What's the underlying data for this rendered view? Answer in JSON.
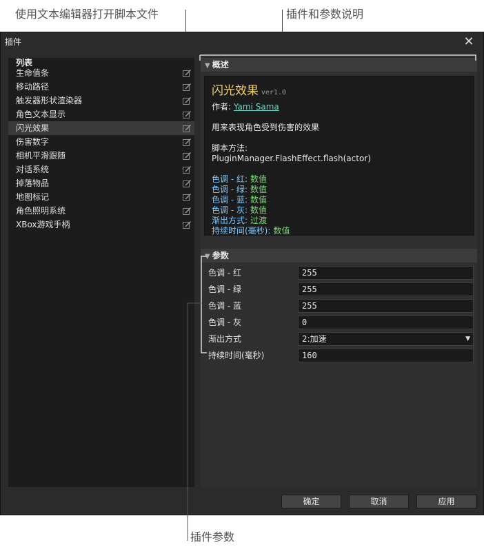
{
  "annotations": {
    "open_in_editor": "使用文本编辑器打开脚本文件",
    "plugin_description": "插件和参数说明",
    "plugin_params": "插件参数"
  },
  "dialog": {
    "title": "插件",
    "close_icon": "close-icon"
  },
  "list": {
    "header": "列表",
    "items": [
      {
        "label": "生命值条"
      },
      {
        "label": "移动路径"
      },
      {
        "label": "触发器形状渲染器"
      },
      {
        "label": "角色文本显示"
      },
      {
        "label": "闪光效果",
        "selected": true
      },
      {
        "label": "伤害数字"
      },
      {
        "label": "相机平滑跟随"
      },
      {
        "label": "对话系统"
      },
      {
        "label": "掉落物品"
      },
      {
        "label": "地图标记"
      },
      {
        "label": "角色照明系统"
      },
      {
        "label": "XBox游戏手柄"
      }
    ],
    "item_icon": "edit-icon"
  },
  "overview": {
    "header": "概述",
    "title": "闪光效果",
    "version": "ver1.0",
    "author_label": "作者:",
    "author_name": "Yami Sama",
    "description": "用来表现角色受到伤害的效果",
    "script_method_label": "脚本方法:",
    "script_method": "PluginManager.FlashEffect.flash(actor)",
    "params": [
      {
        "name": "色调 - 红:",
        "type": "数值"
      },
      {
        "name": "色调 - 绿:",
        "type": "数值"
      },
      {
        "name": "色调 - 蓝:",
        "type": "数值"
      },
      {
        "name": "色调 - 灰:",
        "type": "数值"
      },
      {
        "name": "渐出方式:",
        "type": "过渡"
      },
      {
        "name": "持续时间(毫秒):",
        "type": "数值"
      }
    ]
  },
  "parameters": {
    "header": "参数",
    "rows": [
      {
        "label": "色调 - 红",
        "value": "255"
      },
      {
        "label": "色调 - 绿",
        "value": "255"
      },
      {
        "label": "色调 - 蓝",
        "value": "255"
      },
      {
        "label": "色调 - 灰",
        "value": "0"
      },
      {
        "label": "渐出方式",
        "value": "2:加速"
      },
      {
        "label": "持续时间(毫秒)",
        "value": "160"
      }
    ]
  },
  "buttons": {
    "ok": "确定",
    "cancel": "取消",
    "apply": "应用"
  }
}
